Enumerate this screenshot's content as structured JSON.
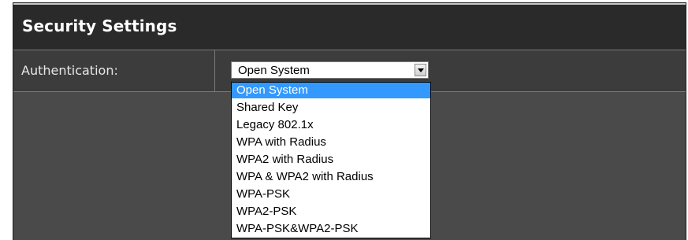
{
  "panel": {
    "title": "Security Settings"
  },
  "authentication": {
    "label": "Authentication:",
    "selected": "Open System",
    "options": [
      "Open System",
      "Shared Key",
      "Legacy 802.1x",
      "WPA with Radius",
      "WPA2 with Radius",
      "WPA & WPA2 with Radius",
      "WPA-PSK",
      "WPA2-PSK",
      "WPA-PSK&WPA2-PSK"
    ],
    "highlighted_index": 0
  },
  "colors": {
    "header_bg": "#2a2a2a",
    "row_bg": "#3c3c3c",
    "panel_bg": "#4a4a4a",
    "highlight": "#3399ff"
  }
}
